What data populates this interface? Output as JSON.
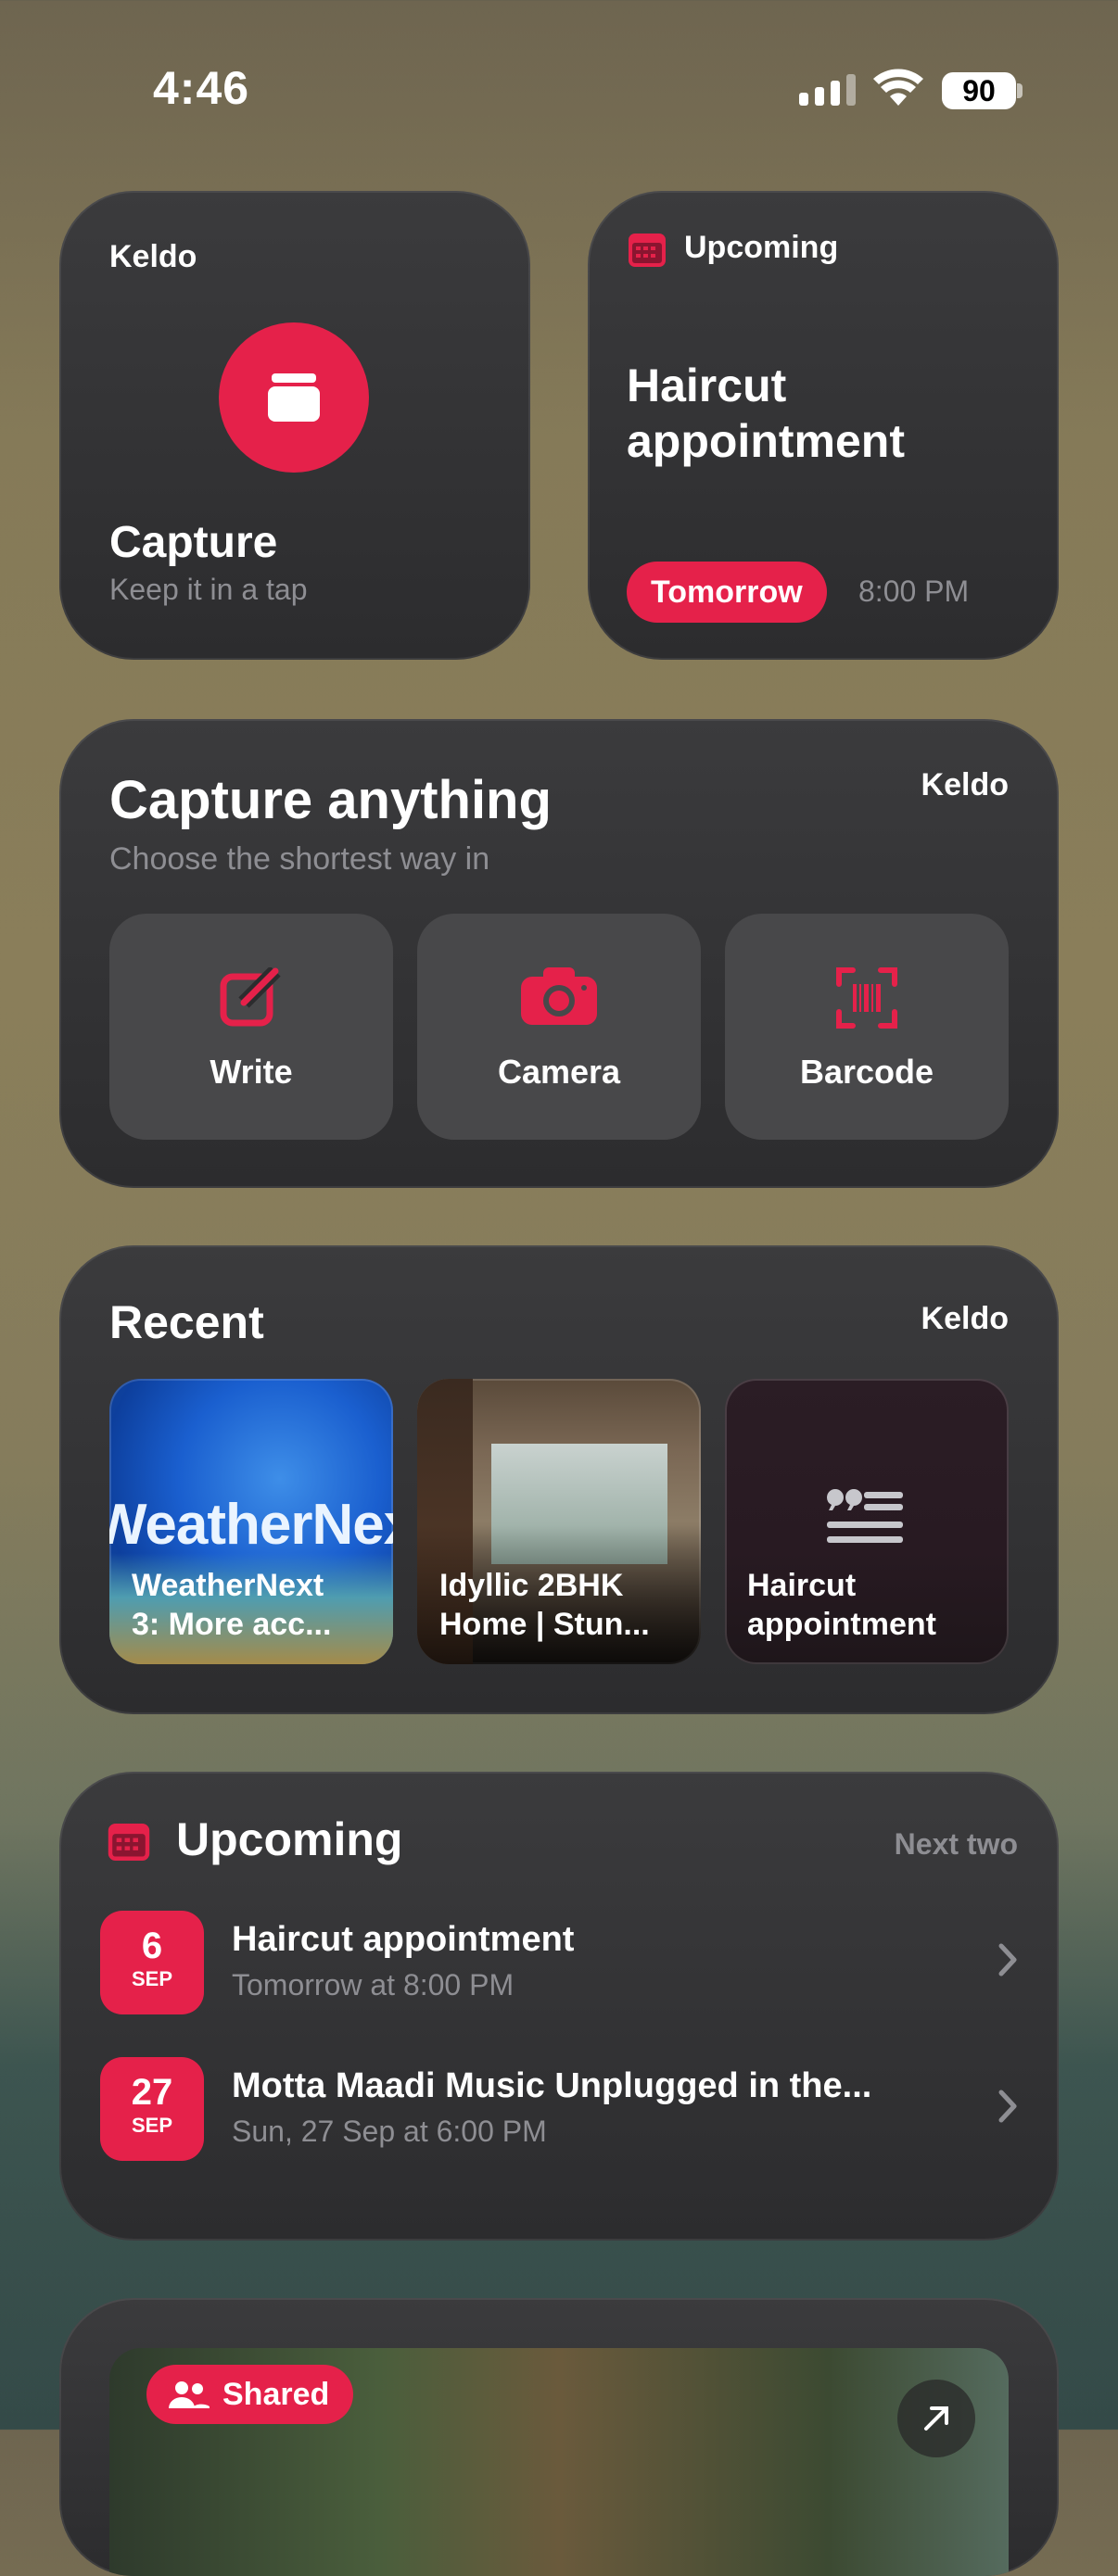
{
  "status_bar": {
    "time": "4:46",
    "battery": "90"
  },
  "capture_widget": {
    "app": "Keldo",
    "title": "Capture",
    "subtitle": "Keep it in a tap"
  },
  "upcoming_small": {
    "label": "Upcoming",
    "title": "Haircut appointment",
    "day": "Tomorrow",
    "time": "8:00 PM"
  },
  "capture_anything": {
    "title": "Capture anything",
    "subtitle": "Choose the shortest way in",
    "app": "Keldo",
    "actions": [
      {
        "label": "Write"
      },
      {
        "label": "Camera"
      },
      {
        "label": "Barcode"
      }
    ]
  },
  "recent": {
    "title": "Recent",
    "app": "Keldo",
    "image_text": "WeatherNext",
    "items": [
      {
        "line1": "WeatherNext",
        "line2": "3: More acc..."
      },
      {
        "line1": "Idyllic 2BHK",
        "line2": "Home | Stun..."
      },
      {
        "line1": "Haircut",
        "line2": "appointment"
      }
    ]
  },
  "upcoming": {
    "title": "Upcoming",
    "right_label": "Next two",
    "events": [
      {
        "day": "6",
        "month": "SEP",
        "title": "Haircut appointment",
        "when": "Tomorrow at 8:00 PM"
      },
      {
        "day": "27",
        "month": "SEP",
        "title": "Motta Maadi Music Unplugged in the...",
        "when": "Sun, 27 Sep at 6:00 PM"
      }
    ]
  },
  "shared_widget": {
    "badge": "Shared"
  },
  "colors": {
    "accent": "#e5214a",
    "card": "#2c2c2e",
    "muted": "#8e8e93"
  }
}
